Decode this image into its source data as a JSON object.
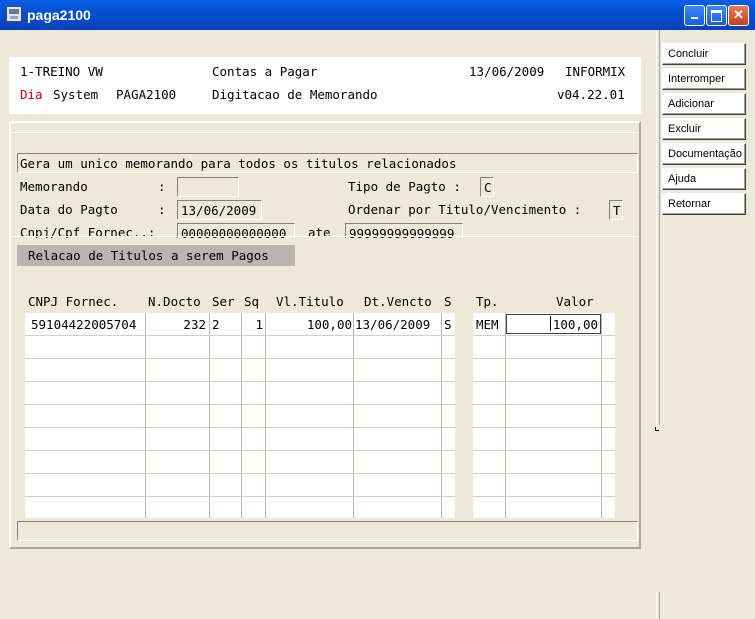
{
  "window": {
    "title": "paga2100"
  },
  "side_buttons": [
    "Concluir",
    "Interromper",
    "Adicionar",
    "Excluir",
    "Documentação",
    "Ajuda",
    "Retornar"
  ],
  "header": {
    "company": "1-TREINO VW",
    "module": "Contas a Pagar",
    "date": "13/06/2009",
    "db": "INFORMIX",
    "dia": "Dia",
    "system": "System",
    "program": "PAGA2100",
    "screen_title": "Digitacao de Memorando",
    "version": "v04.22.01"
  },
  "form": {
    "message": "Gera um unico memorando para todos os titulos relacionados",
    "memorando_label": "Memorando",
    "memorando_value": "",
    "colon": ":",
    "tipo_pagto_label": "Tipo de Pagto :",
    "tipo_pagto_value": "C",
    "data_pagto_label": "Data do Pagto",
    "data_pagto_value": "13/06/2009",
    "ordenar_label": "Ordenar por Titulo/Vencimento :",
    "ordenar_value": "T",
    "cnpj_label": "Cnpj/Cpf Fornec..:",
    "cnpj_from": "00000000000000",
    "ate": "ate",
    "cnpj_to": "99999999999999",
    "group_title": "Relacao de Titulos a serem Pagos"
  },
  "table": {
    "headers": {
      "cnpj": "CNPJ Fornec.",
      "docto": "N.Docto",
      "ser": "Ser",
      "sq": "Sq",
      "vl": "Vl.Titulo",
      "dt": "Dt.Vencto",
      "s": "S",
      "tp": "Tp.",
      "valor": "Valor"
    },
    "rows": [
      {
        "cnpj": "59104422005704",
        "docto": "232",
        "ser": "2",
        "sq": "1",
        "vl": "100,00",
        "dt": "13/06/2009",
        "s": "S",
        "tp": "MEM",
        "valor": "100,00"
      }
    ]
  }
}
